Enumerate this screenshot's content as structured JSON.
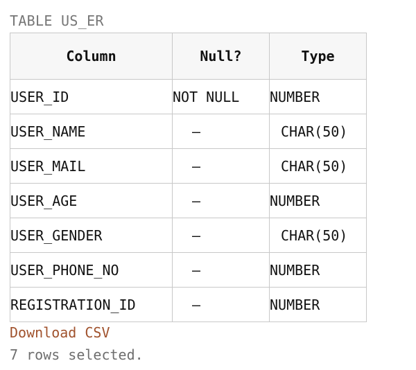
{
  "table_title": "TABLE US_ER",
  "columns": {
    "column": "Column",
    "null": "Null?",
    "type": "Type"
  },
  "rows": [
    {
      "name": "USER_ID",
      "null": "NOT NULL",
      "type": "NUMBER"
    },
    {
      "name": "USER_NAME",
      "null": "–",
      "type": "CHAR(50)"
    },
    {
      "name": "USER_MAIL",
      "null": "–",
      "type": "CHAR(50)"
    },
    {
      "name": "USER_AGE",
      "null": "–",
      "type": "NUMBER"
    },
    {
      "name": "USER_GENDER",
      "null": "–",
      "type": "CHAR(50)"
    },
    {
      "name": "USER_PHONE_NO",
      "null": "–",
      "type": "NUMBER"
    },
    {
      "name": "REGISTRATION_ID",
      "null": "–",
      "type": "NUMBER"
    }
  ],
  "download_label": "Download CSV",
  "status": "7 rows selected.",
  "colors": {
    "link": "#a0522d",
    "muted": "#767676",
    "border": "#c8c8c8",
    "header_bg": "#f7f7f7"
  }
}
